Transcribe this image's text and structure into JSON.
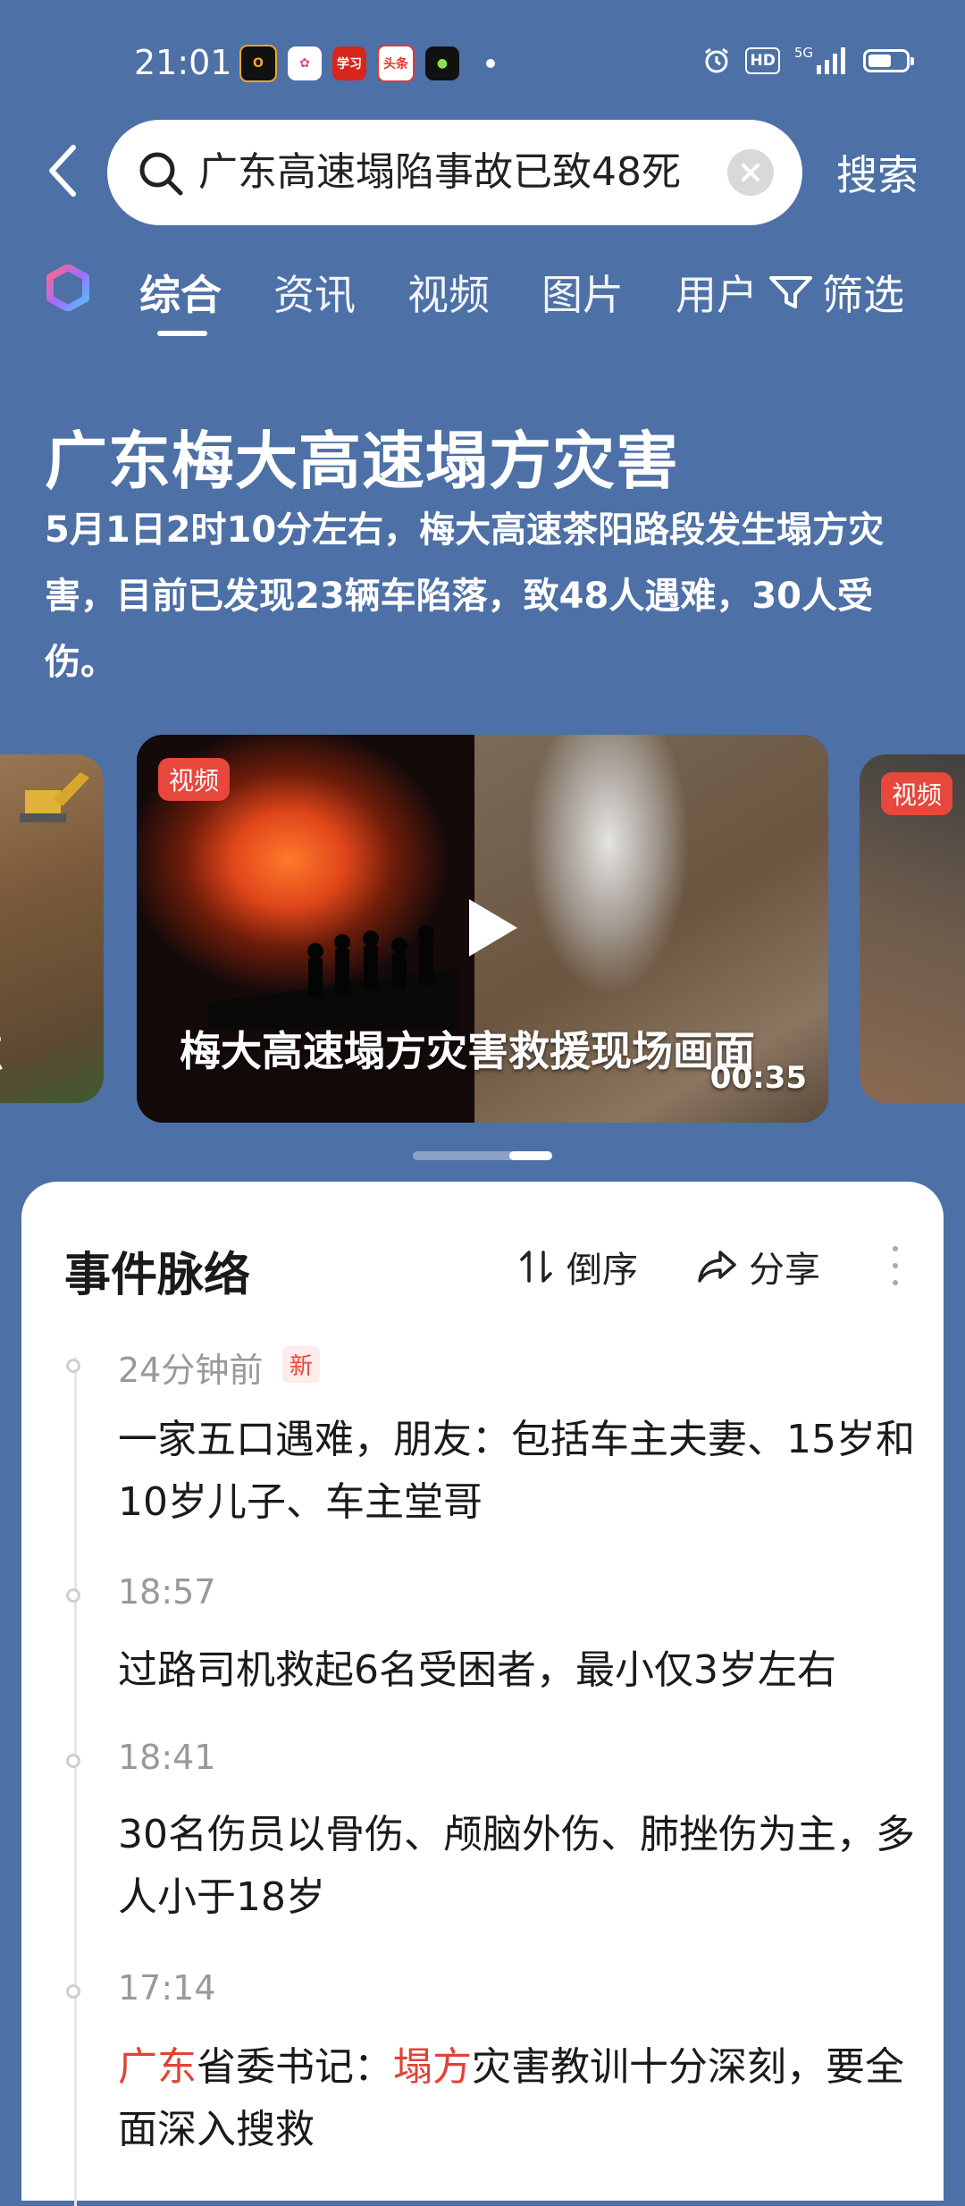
{
  "status_bar": {
    "time": "21:01",
    "app_icons": [
      "O",
      "✿",
      "学习",
      "头条",
      "●"
    ],
    "right_icons": [
      "alarm-icon",
      "HD",
      "5G",
      "signal-icon",
      "battery-icon"
    ],
    "hd": "HD",
    "net": "5G"
  },
  "search": {
    "query": "广东高速塌陷事故已致48死",
    "action_label": "搜索"
  },
  "tabs": [
    {
      "label": "综合",
      "active": true
    },
    {
      "label": "资讯"
    },
    {
      "label": "视频"
    },
    {
      "label": "图片"
    },
    {
      "label": "用户"
    }
  ],
  "filter_label": "筛选",
  "event": {
    "title": "广东梅大高速塌方灾害",
    "summary": "5月1日2时10分左右，梅大高速茶阳路段发生塌方灾害，目前已发现23辆车陷落，致48人遇难，30人受伤。"
  },
  "carousel": {
    "left_caption": "点",
    "main": {
      "badge": "视频",
      "title": "梅大高速塌方灾害救援现场画面",
      "duration": "00:35"
    },
    "right_badge": "视频"
  },
  "timeline": {
    "title": "事件脉络",
    "sort_label": "倒序",
    "share_label": "分享",
    "new_badge": "新",
    "items": [
      {
        "time": "24分钟前",
        "text": "一家五口遇难，朋友：包括车主夫妻、15岁和10岁儿子、车主堂哥"
      },
      {
        "time": "18:57",
        "text": "过路司机救起6名受困者，最小仅3岁左右"
      },
      {
        "time": "18:41",
        "text": "30名伤员以骨伤、颅脑外伤、肺挫伤为主，多人小于18岁"
      },
      {
        "time": "17:14",
        "text_parts": [
          "广东",
          "省委书记：",
          "塌方",
          "灾害教训十分深刻，要全面深入搜救"
        ]
      }
    ]
  },
  "colors": {
    "background": "#4d70a6",
    "badge_red": "#e8473b",
    "highlight_red": "#e24236"
  }
}
